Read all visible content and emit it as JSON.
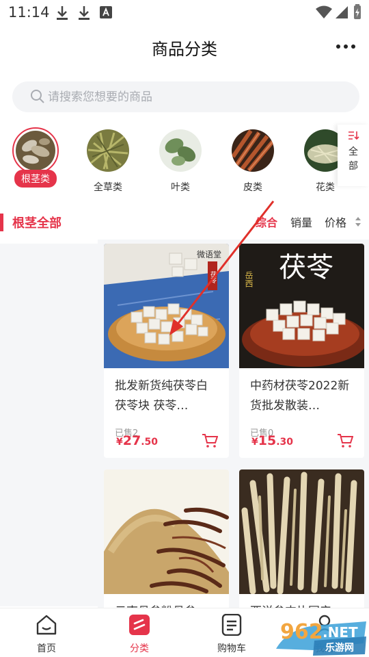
{
  "status_bar": {
    "time": "11:14"
  },
  "header": {
    "title": "商品分类"
  },
  "search": {
    "placeholder": "请搜索您想要的商品"
  },
  "categories": [
    {
      "label": "根茎类",
      "active": true
    },
    {
      "label": "全草类"
    },
    {
      "label": "叶类"
    },
    {
      "label": "皮类"
    },
    {
      "label": "花类"
    }
  ],
  "all_categories_label": "全部",
  "section": {
    "title": "根茎全部",
    "sort": {
      "comprehensive": "综合",
      "sales": "销量",
      "price": "价格"
    }
  },
  "products": [
    {
      "name": "批发新货纯茯苓白茯苓块 茯苓…",
      "sold": "已售2",
      "price_symbol": "¥",
      "price_int": "27",
      "price_dec": ".50",
      "photo_text_1": "微语堂",
      "photo_text_2": "茯苓"
    },
    {
      "name": "中药材茯苓2022新货批发散装…",
      "sold": "已售0",
      "price_symbol": "¥",
      "price_int": "15",
      "price_dec": ".30",
      "photo_text_1": "茯苓",
      "photo_text_2": "岳西"
    },
    {
      "name": "云南丹参粉丹参…",
      "sold": "",
      "price_symbol": "",
      "price_int": "",
      "price_dec": ""
    },
    {
      "name": "西洋参支片国产…",
      "sold": "",
      "price_symbol": "",
      "price_int": "",
      "price_dec": ""
    }
  ],
  "bottom_nav": [
    {
      "label": "首页"
    },
    {
      "label": "分类",
      "active": true
    },
    {
      "label": "购物车"
    },
    {
      "label": "我的"
    }
  ],
  "watermark": {
    "text_1": "962",
    "text_2": ".NET",
    "text_3": "乐游网"
  },
  "colors": {
    "accent": "#e5344a",
    "search_bg": "#f3f4f6",
    "pane_bg": "#f5f6f8"
  }
}
